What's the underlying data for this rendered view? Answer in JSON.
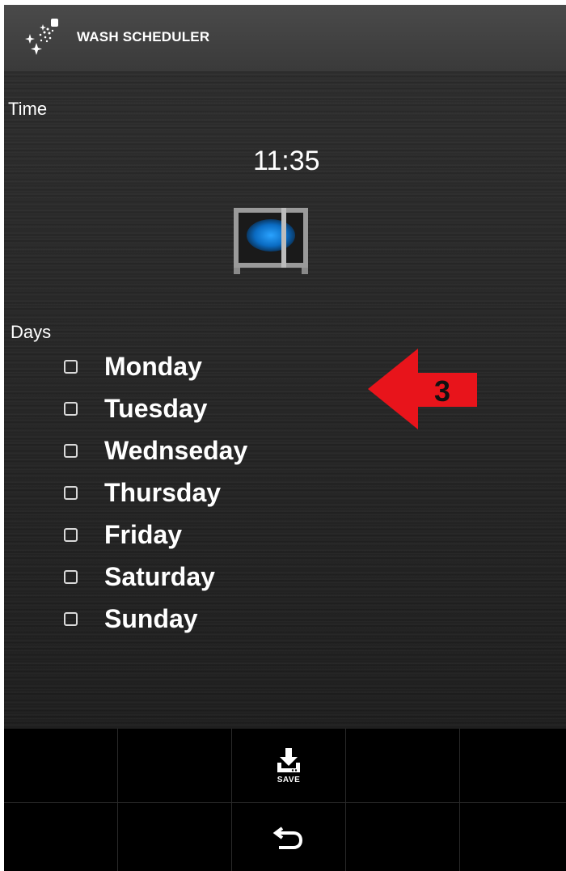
{
  "header": {
    "title": "WASH SCHEDULER",
    "app_icon": "sparkle-spray-icon"
  },
  "time_section": {
    "label": "Time",
    "value": "11:35",
    "device_icon": "tv-screen-icon"
  },
  "days_section": {
    "label": "Days",
    "days": [
      {
        "label": "Monday",
        "checked": false
      },
      {
        "label": "Tuesday",
        "checked": false
      },
      {
        "label": "Wednseday",
        "checked": false
      },
      {
        "label": "Thursday",
        "checked": false
      },
      {
        "label": "Friday",
        "checked": false
      },
      {
        "label": "Saturday",
        "checked": false
      },
      {
        "label": "Sunday",
        "checked": false
      }
    ]
  },
  "annotation": {
    "step_number": "3",
    "color": "#e8141b"
  },
  "toolbar": {
    "save_label": "SAVE",
    "save_icon": "download-icon",
    "back_icon": "back-arrow-icon"
  },
  "colors": {
    "appbar": "#444444",
    "background": "#262626",
    "accent_blue": "#1d8fe6",
    "text": "#ffffff"
  }
}
